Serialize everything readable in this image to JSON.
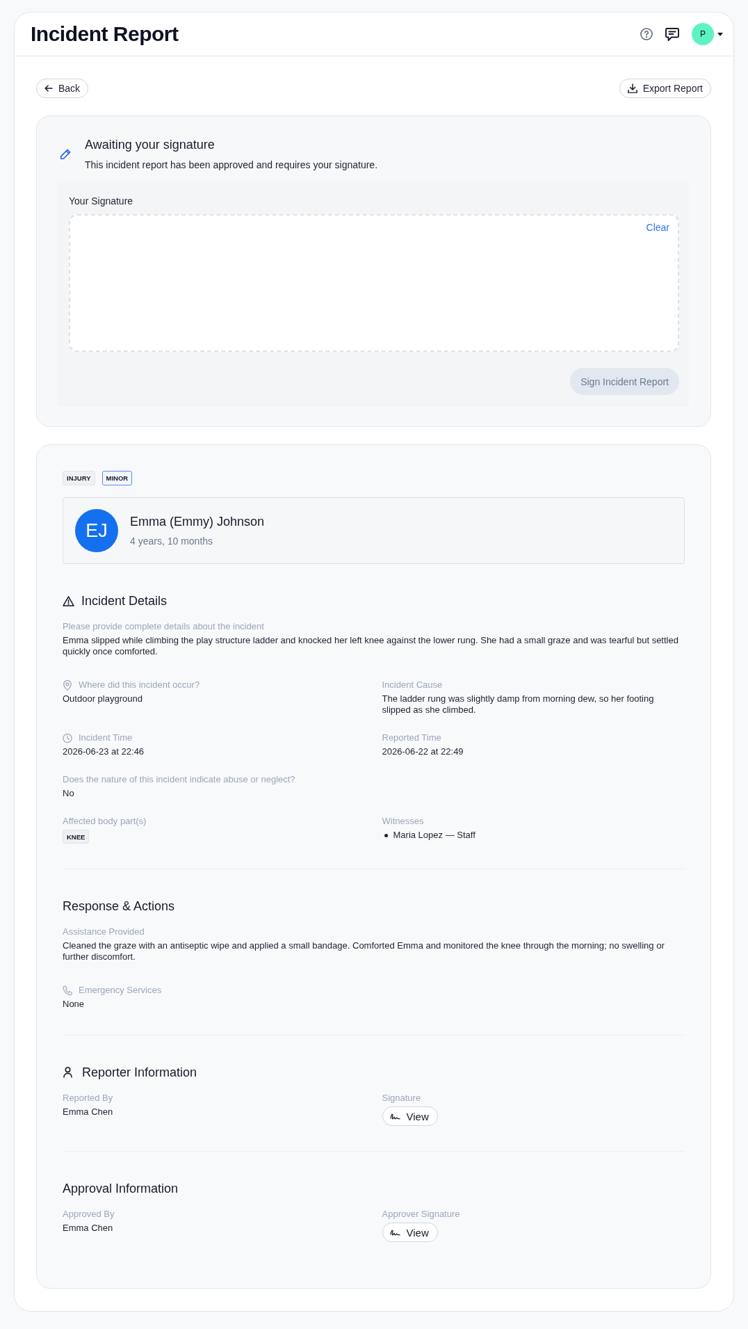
{
  "header": {
    "title": "Incident Report",
    "avatar": "P"
  },
  "toolbar": {
    "back": "Back",
    "export": "Export Report"
  },
  "signature_prompt": {
    "title": "Awaiting your signature",
    "message": "This incident report has been approved and requires your signature.",
    "field_label": "Your Signature",
    "clear": "Clear",
    "sign_button": {
      "label": "Sign Incident Report",
      "disabled": true
    }
  },
  "report": {
    "tags": [
      {
        "label": "INJURY",
        "kind": "category"
      },
      {
        "label": "MINOR",
        "kind": "severity"
      }
    ],
    "child": {
      "initials": "EJ",
      "name": "Emma (Emmy) Johnson",
      "age": "4 years, 10 months"
    },
    "sections": [
      {
        "kind": "details",
        "title": "Incident Details",
        "rows": [
          [
            {
              "kind": "paragraph",
              "label": "Please provide complete details about the incident",
              "value": "Emma slipped while climbing the play structure ladder and knocked her left knee against the lower rung. She had a small graze and was tearful but settled quickly once comforted."
            }
          ],
          [
            {
              "kind": "location",
              "label": "Where did this incident occur?",
              "value": "Outdoor playground"
            },
            {
              "kind": "text",
              "label": "Incident Cause",
              "value": "The ladder rung was slightly damp from morning dew, so her footing slipped as she climbed."
            }
          ],
          [
            {
              "kind": "time",
              "label": "Incident Time",
              "value": "2026-06-23 at 22:46"
            },
            {
              "kind": "text",
              "label": "Reported Time",
              "value": "2026-06-22 at 22:49"
            }
          ],
          [
            {
              "kind": "text",
              "label": "Does the nature of this incident indicate abuse or neglect?",
              "value": "No"
            }
          ],
          [
            {
              "kind": "tags",
              "label": "Affected body part(s)",
              "tags": [
                "KNEE"
              ]
            },
            {
              "kind": "list",
              "label": "Witnesses",
              "items": [
                "Maria Lopez — Staff"
              ]
            }
          ]
        ]
      },
      {
        "kind": "response",
        "title": "Response & Actions",
        "rows": [
          [
            {
              "kind": "paragraph",
              "label": "Assistance Provided",
              "value": "Cleaned the graze with an antiseptic wipe and applied a small bandage. Comforted Emma and monitored the knee through the morning; no swelling or further discomfort."
            }
          ],
          [
            {
              "kind": "phone",
              "label": "Emergency Services",
              "value": "None"
            }
          ]
        ]
      },
      {
        "kind": "reporter",
        "title": "Reporter Information",
        "rows": [
          [
            {
              "kind": "text",
              "label": "Reported By",
              "value": "Emma Chen"
            },
            {
              "kind": "signature",
              "label": "Signature",
              "button": "View"
            }
          ]
        ]
      },
      {
        "kind": "approval",
        "title": "Approval Information",
        "rows": [
          [
            {
              "kind": "text",
              "label": "Approved By",
              "value": "Emma Chen"
            },
            {
              "kind": "signature",
              "label": "Approver Signature",
              "button": "View"
            }
          ]
        ]
      }
    ]
  }
}
